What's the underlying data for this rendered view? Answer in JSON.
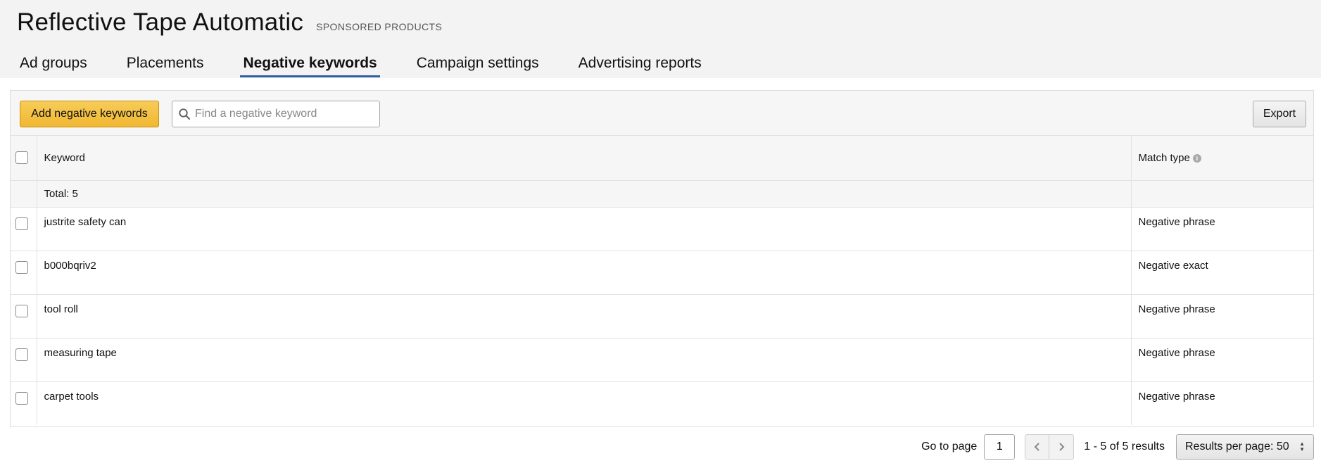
{
  "header": {
    "title": "Reflective Tape Automatic",
    "subtitle": "SPONSORED PRODUCTS"
  },
  "tabs": [
    {
      "label": "Ad groups"
    },
    {
      "label": "Placements"
    },
    {
      "label": "Negative keywords",
      "active": true
    },
    {
      "label": "Campaign settings"
    },
    {
      "label": "Advertising reports"
    }
  ],
  "toolbar": {
    "add_label": "Add negative keywords",
    "search_placeholder": "Find a negative keyword",
    "export_label": "Export"
  },
  "table": {
    "columns": {
      "keyword": "Keyword",
      "match_type": "Match type"
    },
    "total_label": "Total: 5",
    "rows": [
      {
        "keyword": "justrite safety can",
        "match_type": "Negative phrase"
      },
      {
        "keyword": "b000bqriv2",
        "match_type": "Negative exact"
      },
      {
        "keyword": "tool roll",
        "match_type": "Negative phrase"
      },
      {
        "keyword": "measuring tape",
        "match_type": "Negative phrase"
      },
      {
        "keyword": "carpet tools",
        "match_type": "Negative phrase"
      }
    ]
  },
  "pagination": {
    "goto_label": "Go to page",
    "page_value": "1",
    "results_text": "1 - 5 of 5 results",
    "per_page_label": "Results per page: 50"
  },
  "colors": {
    "accent": "#2f5fa5",
    "primary_button": "#f1b732"
  }
}
